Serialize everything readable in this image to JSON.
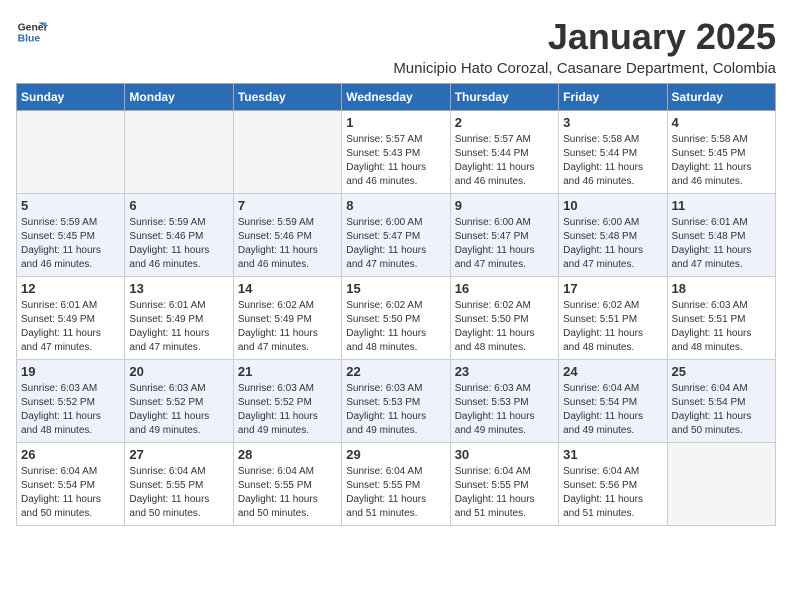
{
  "header": {
    "logo_line1": "General",
    "logo_line2": "Blue",
    "month_title": "January 2025",
    "subtitle": "Municipio Hato Corozal, Casanare Department, Colombia"
  },
  "days_of_week": [
    "Sunday",
    "Monday",
    "Tuesday",
    "Wednesday",
    "Thursday",
    "Friday",
    "Saturday"
  ],
  "weeks": [
    {
      "days": [
        {
          "number": "",
          "info": ""
        },
        {
          "number": "",
          "info": ""
        },
        {
          "number": "",
          "info": ""
        },
        {
          "number": "1",
          "info": "Sunrise: 5:57 AM\nSunset: 5:43 PM\nDaylight: 11 hours\nand 46 minutes."
        },
        {
          "number": "2",
          "info": "Sunrise: 5:57 AM\nSunset: 5:44 PM\nDaylight: 11 hours\nand 46 minutes."
        },
        {
          "number": "3",
          "info": "Sunrise: 5:58 AM\nSunset: 5:44 PM\nDaylight: 11 hours\nand 46 minutes."
        },
        {
          "number": "4",
          "info": "Sunrise: 5:58 AM\nSunset: 5:45 PM\nDaylight: 11 hours\nand 46 minutes."
        }
      ]
    },
    {
      "days": [
        {
          "number": "5",
          "info": "Sunrise: 5:59 AM\nSunset: 5:45 PM\nDaylight: 11 hours\nand 46 minutes."
        },
        {
          "number": "6",
          "info": "Sunrise: 5:59 AM\nSunset: 5:46 PM\nDaylight: 11 hours\nand 46 minutes."
        },
        {
          "number": "7",
          "info": "Sunrise: 5:59 AM\nSunset: 5:46 PM\nDaylight: 11 hours\nand 46 minutes."
        },
        {
          "number": "8",
          "info": "Sunrise: 6:00 AM\nSunset: 5:47 PM\nDaylight: 11 hours\nand 47 minutes."
        },
        {
          "number": "9",
          "info": "Sunrise: 6:00 AM\nSunset: 5:47 PM\nDaylight: 11 hours\nand 47 minutes."
        },
        {
          "number": "10",
          "info": "Sunrise: 6:00 AM\nSunset: 5:48 PM\nDaylight: 11 hours\nand 47 minutes."
        },
        {
          "number": "11",
          "info": "Sunrise: 6:01 AM\nSunset: 5:48 PM\nDaylight: 11 hours\nand 47 minutes."
        }
      ]
    },
    {
      "days": [
        {
          "number": "12",
          "info": "Sunrise: 6:01 AM\nSunset: 5:49 PM\nDaylight: 11 hours\nand 47 minutes."
        },
        {
          "number": "13",
          "info": "Sunrise: 6:01 AM\nSunset: 5:49 PM\nDaylight: 11 hours\nand 47 minutes."
        },
        {
          "number": "14",
          "info": "Sunrise: 6:02 AM\nSunset: 5:49 PM\nDaylight: 11 hours\nand 47 minutes."
        },
        {
          "number": "15",
          "info": "Sunrise: 6:02 AM\nSunset: 5:50 PM\nDaylight: 11 hours\nand 48 minutes."
        },
        {
          "number": "16",
          "info": "Sunrise: 6:02 AM\nSunset: 5:50 PM\nDaylight: 11 hours\nand 48 minutes."
        },
        {
          "number": "17",
          "info": "Sunrise: 6:02 AM\nSunset: 5:51 PM\nDaylight: 11 hours\nand 48 minutes."
        },
        {
          "number": "18",
          "info": "Sunrise: 6:03 AM\nSunset: 5:51 PM\nDaylight: 11 hours\nand 48 minutes."
        }
      ]
    },
    {
      "days": [
        {
          "number": "19",
          "info": "Sunrise: 6:03 AM\nSunset: 5:52 PM\nDaylight: 11 hours\nand 48 minutes."
        },
        {
          "number": "20",
          "info": "Sunrise: 6:03 AM\nSunset: 5:52 PM\nDaylight: 11 hours\nand 49 minutes."
        },
        {
          "number": "21",
          "info": "Sunrise: 6:03 AM\nSunset: 5:52 PM\nDaylight: 11 hours\nand 49 minutes."
        },
        {
          "number": "22",
          "info": "Sunrise: 6:03 AM\nSunset: 5:53 PM\nDaylight: 11 hours\nand 49 minutes."
        },
        {
          "number": "23",
          "info": "Sunrise: 6:03 AM\nSunset: 5:53 PM\nDaylight: 11 hours\nand 49 minutes."
        },
        {
          "number": "24",
          "info": "Sunrise: 6:04 AM\nSunset: 5:54 PM\nDaylight: 11 hours\nand 49 minutes."
        },
        {
          "number": "25",
          "info": "Sunrise: 6:04 AM\nSunset: 5:54 PM\nDaylight: 11 hours\nand 50 minutes."
        }
      ]
    },
    {
      "days": [
        {
          "number": "26",
          "info": "Sunrise: 6:04 AM\nSunset: 5:54 PM\nDaylight: 11 hours\nand 50 minutes."
        },
        {
          "number": "27",
          "info": "Sunrise: 6:04 AM\nSunset: 5:55 PM\nDaylight: 11 hours\nand 50 minutes."
        },
        {
          "number": "28",
          "info": "Sunrise: 6:04 AM\nSunset: 5:55 PM\nDaylight: 11 hours\nand 50 minutes."
        },
        {
          "number": "29",
          "info": "Sunrise: 6:04 AM\nSunset: 5:55 PM\nDaylight: 11 hours\nand 51 minutes."
        },
        {
          "number": "30",
          "info": "Sunrise: 6:04 AM\nSunset: 5:55 PM\nDaylight: 11 hours\nand 51 minutes."
        },
        {
          "number": "31",
          "info": "Sunrise: 6:04 AM\nSunset: 5:56 PM\nDaylight: 11 hours\nand 51 minutes."
        },
        {
          "number": "",
          "info": ""
        }
      ]
    }
  ]
}
